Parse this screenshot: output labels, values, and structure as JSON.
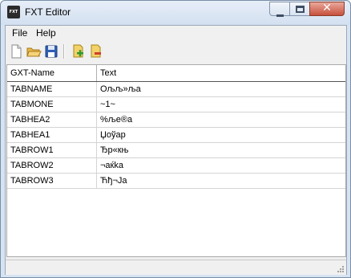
{
  "window": {
    "title": "FXT Editor",
    "app_icon_text": "FXT",
    "close_glyph": "✕"
  },
  "menu": {
    "items": [
      {
        "label": "File"
      },
      {
        "label": "Help"
      }
    ]
  },
  "toolbar": {
    "buttons": [
      {
        "icon": "new-file-icon"
      },
      {
        "icon": "open-folder-icon"
      },
      {
        "icon": "save-disk-icon"
      },
      {
        "icon": "add-entry-icon"
      },
      {
        "icon": "remove-entry-icon"
      }
    ]
  },
  "grid": {
    "columns": [
      "GXT-Name",
      "Text"
    ],
    "rows": [
      {
        "name": "TABNAME",
        "text": "Ољљ»љa"
      },
      {
        "name": "TABMONE",
        "text": "~1~"
      },
      {
        "name": "TABHEA2",
        "text": "%љe®a"
      },
      {
        "name": "TABHEA1",
        "text": "Џоўар"
      },
      {
        "name": "TABROW1",
        "text": "Ђр«књ"
      },
      {
        "name": "TABROW2",
        "text": "¬aќka"
      },
      {
        "name": "TABROW3",
        "text": "Ћђ¬Ja"
      }
    ]
  },
  "colors": {
    "title_bg": "#dce7f5",
    "close_button": "#c7503c",
    "grid_bg": "#ffffff",
    "chrome_bg": "#f0f0f0"
  }
}
